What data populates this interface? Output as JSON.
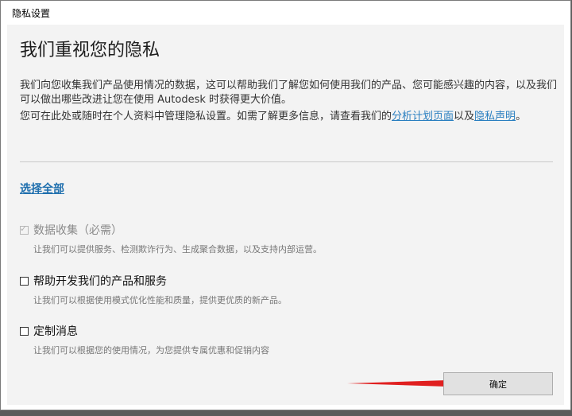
{
  "window": {
    "title": "隐私设置"
  },
  "content": {
    "heading": "我们重视您的隐私",
    "para1": "我们向您收集我们产品使用情况的数据，这可以帮助我们了解您如何使用我们的产品、您可能感兴趣的内容，以及我们可以做出哪些改进让您在使用 Autodesk 时获得更大价值。",
    "para2_before": "您可在此处或随时在个人资料中管理隐私设置。如需了解更多信息，请查看我们的",
    "link_analytics": "分析计划页面",
    "para2_middle": "以及",
    "link_privacy": "隐私声明",
    "para2_after": "。",
    "select_all": "选择全部"
  },
  "options": [
    {
      "label": "数据收集（必需）",
      "description": "让我们可以提供服务、检测欺诈行为、生成聚合数据，以及支持内部运营。",
      "checked": true,
      "disabled": true
    },
    {
      "label": "帮助开发我们的产品和服务",
      "description": "让我们可以根据使用模式优化性能和质量，提供更优质的新产品。",
      "checked": false,
      "disabled": false
    },
    {
      "label": "定制消息",
      "description": "让我们可以根据您的使用情况，为您提供专属优惠和促销内容",
      "checked": false,
      "disabled": false
    }
  ],
  "footer": {
    "ok_label": "确定"
  },
  "colors": {
    "link": "#2a7fc0",
    "arrow": "#e02020"
  }
}
